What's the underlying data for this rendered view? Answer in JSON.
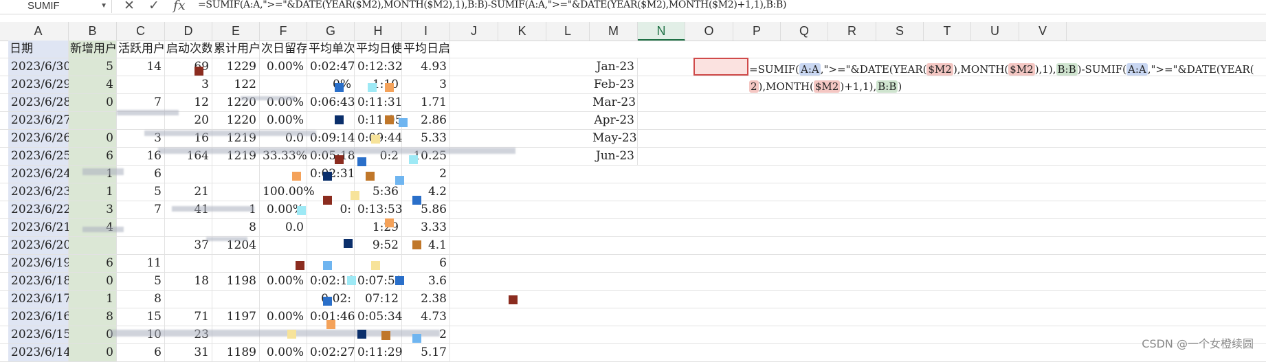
{
  "formula_bar": {
    "name_box": "SUMIF",
    "cancel_icon": "close-icon",
    "confirm_icon": "check-icon",
    "fx_label": "fx",
    "formula": "=SUMIF(A:A,\">=\"&DATE(YEAR($M2),MONTH($M2),1),B:B)-SUMIF(A:A,\">=\"&DATE(YEAR($M2),MONTH($M2)+1,1),B:B)"
  },
  "columns": [
    "A",
    "B",
    "C",
    "D",
    "E",
    "F",
    "G",
    "H",
    "I",
    "J",
    "K",
    "L",
    "M",
    "N",
    "O",
    "P",
    "Q",
    "R",
    "S",
    "T",
    "U",
    "V"
  ],
  "selected_column": "N",
  "headers": [
    "日期",
    "新增用户",
    "活跃用户",
    "启动次数",
    "累计用户",
    "次日留存",
    "平均单次",
    "平均日使",
    "平均日启动次数"
  ],
  "rows": [
    [
      "2023/6/30",
      "5",
      "14",
      "69",
      "1229",
      "0.00%",
      "0:02:47",
      "0:12:32",
      "4.93"
    ],
    [
      "2023/6/29",
      "4",
      "",
      "3",
      "122",
      "",
      "0%",
      "1:10",
      "3"
    ],
    [
      "2023/6/28",
      "0",
      "7",
      "12",
      "1220",
      "0.00%",
      "0:06:43",
      "0:11:31",
      "1.71"
    ],
    [
      "2023/6/27",
      "",
      "",
      "20",
      "1220",
      "0.00%",
      "",
      "0:11:05",
      "2.86"
    ],
    [
      "2023/6/26",
      "0",
      "3",
      "16",
      "1219",
      "0.0",
      "0:09:14",
      "0:09:44",
      "5.33"
    ],
    [
      "2023/6/25",
      "6",
      "16",
      "164",
      "1219",
      "33.33%",
      "0:05:18",
      "0:2",
      "10.25"
    ],
    [
      "2023/6/24",
      "1",
      "6",
      "",
      "",
      "",
      "0:02:31",
      "",
      "2"
    ],
    [
      "2023/6/23",
      "1",
      "5",
      "21",
      "",
      "100.00%",
      "",
      "5:36",
      "4.2"
    ],
    [
      "2023/6/22",
      "3",
      "7",
      "41",
      "1",
      "0.00%",
      "0:",
      "0:13:53",
      "5.86"
    ],
    [
      "2023/6/21",
      "4",
      "",
      "",
      "8",
      "0.0",
      "",
      "1:29",
      "3.33"
    ],
    [
      "2023/6/20",
      "",
      "",
      "37",
      "1204",
      "",
      "",
      "9:52",
      "4.1"
    ],
    [
      "2023/6/19",
      "6",
      "11",
      "",
      "",
      "",
      "",
      "",
      "6"
    ],
    [
      "2023/6/18",
      "0",
      "5",
      "18",
      "1198",
      "0.00%",
      "0:02:18",
      "0:07:51",
      "3.6"
    ],
    [
      "2023/6/17",
      "1",
      "8",
      "",
      "",
      "",
      "0:02:",
      "07:12",
      "2.38"
    ],
    [
      "2023/6/16",
      "8",
      "15",
      "71",
      "1197",
      "0.00%",
      "0:01:46",
      "0:05:34",
      "4.73"
    ],
    [
      "2023/6/15",
      "0",
      "10",
      "23",
      "",
      "",
      "",
      "",
      "2"
    ],
    [
      "2023/6/14",
      "0",
      "6",
      "31",
      "1189",
      "0.00%",
      "0:02:27",
      "0:11:29",
      "5.17"
    ]
  ],
  "months": [
    "Jan-23",
    "Feb-23",
    "Mar-23",
    "Apr-23",
    "May-23",
    "Jun-23"
  ],
  "cell_formula": {
    "line1_parts": [
      "=SUMIF(",
      "A:A",
      ",\">=\"&DATE(YEAR(",
      "$M2",
      "),MONTH(",
      "$M2",
      "),1),",
      "B:B",
      ")-SUMIF(",
      "A:A",
      ",\">=\"&DATE(YEAR("
    ],
    "line2_parts": [
      "2",
      "),MONTH(",
      "$M2",
      ")+1,1),",
      "B:B",
      ")"
    ]
  },
  "watermark": "CSDN @一个女橙续圆",
  "colors": {
    "accent": "#1e7145",
    "active_border": "#d04a4a"
  }
}
